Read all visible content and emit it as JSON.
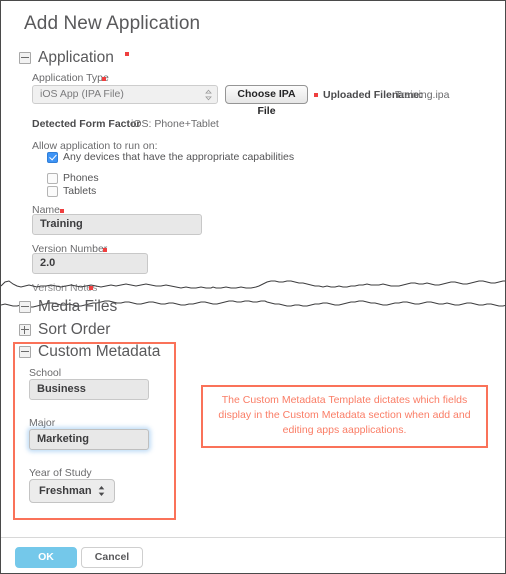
{
  "dialog": {
    "title": "Add New Application"
  },
  "sections": {
    "application": {
      "label": "Application",
      "toggle": "minus-icon"
    },
    "media_files": {
      "label": "Media Files",
      "toggle": "minus-icon"
    },
    "sort_order": {
      "label": "Sort Order",
      "toggle": "plus-icon"
    },
    "custom_metadata": {
      "label": "Custom Metadata",
      "toggle": "minus-icon"
    }
  },
  "application": {
    "app_type_label": "Application Type",
    "app_type_value": "iOS App (IPA File)",
    "choose_file_label": "Choose IPA File",
    "uploaded_filename_label": "Uploaded Filename:",
    "uploaded_filename_value": "Training.ipa",
    "detected_form_factor_label": "Detected Form Factor",
    "detected_form_factor_value": "iOS: Phone+Tablet",
    "allow_run_label": "Allow application to run on:",
    "checkbox_any_devices": "Any devices that have the appropriate capabilities",
    "checkbox_phones": "Phones",
    "checkbox_tablets": "Tablets",
    "name_label": "Name",
    "name_value": "Training",
    "version_label": "Version Number",
    "version_value": "2.0",
    "version_notes_label": "Version Notes"
  },
  "custom_metadata": {
    "school_label": "School",
    "school_value": "Business",
    "major_label": "Major",
    "major_value": "Marketing",
    "year_label": "Year of Study",
    "year_value": "Freshman"
  },
  "callout": {
    "text": "The Custom Metadata Template dictates which fields display in the Custom Metadata section when add and editing apps aapplications."
  },
  "footer": {
    "ok_label": "OK",
    "cancel_label": "Cancel"
  },
  "colors": {
    "accent_orange": "#fa7259",
    "ok_blue": "#74c8ea",
    "required_red": "#ef3f3f",
    "checkbox_blue": "#3d93f5"
  }
}
